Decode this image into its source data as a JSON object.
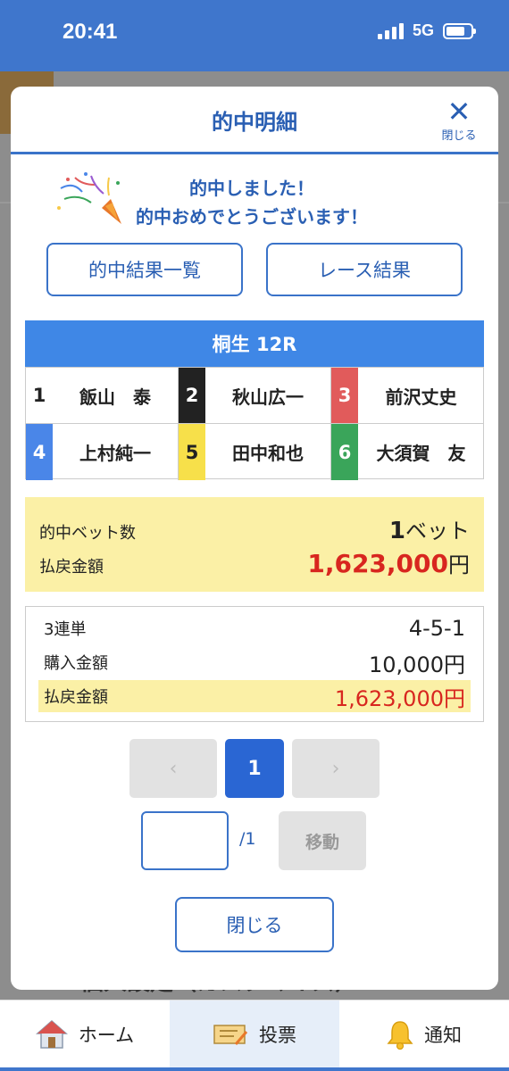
{
  "status_bar": {
    "time": "20:41",
    "network": "5G"
  },
  "background": {
    "section_text": "個人設定（カスタマイズ）"
  },
  "modal": {
    "title": "的中明細",
    "close_icon_label": "閉じる",
    "congrats_line1": "的中しました！",
    "congrats_line2": "的中おめでとうございます！",
    "results_list_button": "的中結果一覧",
    "race_results_button": "レース結果",
    "race_title": "桐生 12R",
    "racers": [
      {
        "num": "1",
        "name": "飯山　泰",
        "bg": "#ffffff",
        "fg": "#222222"
      },
      {
        "num": "2",
        "name": "秋山広一",
        "bg": "#222222",
        "fg": "#ffffff"
      },
      {
        "num": "3",
        "name": "前沢丈史",
        "bg": "#e15b5b",
        "fg": "#ffffff"
      },
      {
        "num": "4",
        "name": "上村純一",
        "bg": "#4a86e8",
        "fg": "#ffffff"
      },
      {
        "num": "5",
        "name": "田中和也",
        "bg": "#f7e04a",
        "fg": "#222222"
      },
      {
        "num": "6",
        "name": "大須賀　友",
        "bg": "#3aa55a",
        "fg": "#ffffff"
      }
    ],
    "summary": {
      "bet_count_label": "的中ベット数",
      "bet_count_value": "1",
      "bet_count_unit": "ベット",
      "payout_label": "払戻金額",
      "payout_value": "1,623,000",
      "payout_unit": "円"
    },
    "detail": {
      "bet_type_label": "3連単",
      "bet_combination": "4-5-1",
      "purchase_label": "購入金額",
      "purchase_value": "10,000円",
      "payout_label": "払戻金額",
      "payout_value": "1,623,000円"
    },
    "pager": {
      "prev": "‹",
      "current": "1",
      "next": "›",
      "total": "/1",
      "jump_button": "移動"
    },
    "close_button": "閉じる"
  },
  "tabbar": {
    "home_label": "ホーム",
    "vote_label": "投票",
    "notify_label": "通知"
  },
  "colors": {
    "brand_blue": "#3f76cc",
    "accent_red": "#d8261f",
    "highlight_yellow": "#fbf0a6"
  }
}
